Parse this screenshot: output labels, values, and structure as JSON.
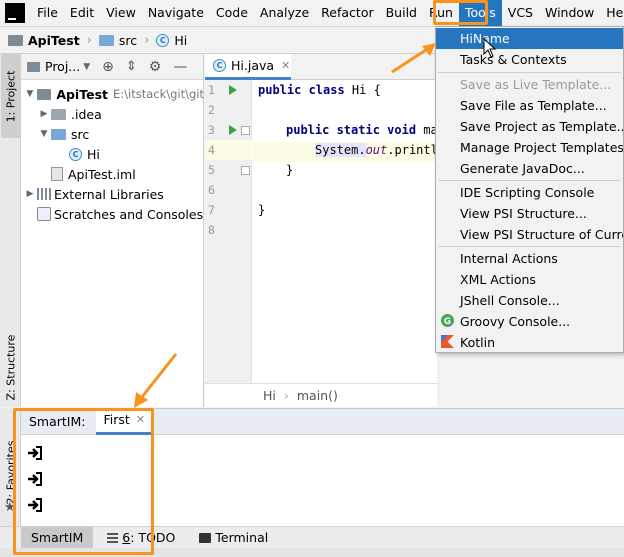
{
  "menubar": {
    "items": [
      "File",
      "Edit",
      "View",
      "Navigate",
      "Code",
      "Analyze",
      "Refactor",
      "Build",
      "Run",
      "Tools",
      "VCS",
      "Window",
      "Help"
    ],
    "active_index": 9
  },
  "navbar": {
    "project": "ApiTest",
    "folder": "src",
    "file": "Hi"
  },
  "left_strip": {
    "project_tab": "1: Project",
    "structure_tab": "Z: Structure",
    "favorites_tab": "2: Favorites"
  },
  "project_panel": {
    "title": "Proj...",
    "tree": [
      {
        "label": "ApiTest",
        "path": "E:\\itstack\\git\\git"
      },
      {
        "label": ".idea"
      },
      {
        "label": "src"
      },
      {
        "label": "Hi"
      },
      {
        "label": "ApiTest.iml"
      },
      {
        "label": "External Libraries"
      },
      {
        "label": "Scratches and Consoles"
      }
    ]
  },
  "editor": {
    "tab_label": "Hi.java",
    "line_numbers": [
      "1",
      "2",
      "3",
      "4",
      "5",
      "6",
      "7",
      "8"
    ],
    "lines": {
      "l1_kw": "public class",
      "l1_rest": " Hi {",
      "l3_kw": "public static void",
      "l3_rest": " ma",
      "l4_a": "System.",
      "l4_b": "out",
      "l4_c": ".printl",
      "l5": "}",
      "l7": "}"
    },
    "breadcrumb": {
      "class": "Hi",
      "method": "main()"
    }
  },
  "tools_menu": {
    "items": [
      {
        "label": "HiName",
        "selected": true
      },
      {
        "label": "Tasks & Contexts"
      },
      {
        "label": "Save as Live Template...",
        "disabled": true
      },
      {
        "label": "Save File as Template..."
      },
      {
        "label": "Save Project as Template..."
      },
      {
        "label": "Manage Project Templates..."
      },
      {
        "label": "Generate JavaDoc..."
      },
      {
        "label": "IDE Scripting Console"
      },
      {
        "label": "View PSI Structure..."
      },
      {
        "label": "View PSI Structure of Current File"
      },
      {
        "label": "Internal Actions"
      },
      {
        "label": "XML Actions"
      },
      {
        "label": "JShell Console..."
      },
      {
        "label": "Groovy Console..."
      },
      {
        "label": "Kotlin"
      }
    ]
  },
  "smartim": {
    "label": "SmartIM:",
    "tab": "First"
  },
  "bottom_tabs": {
    "smartim": "SmartIM",
    "todo_num": "6",
    "todo_rest": ": TODO",
    "terminal": "Terminal"
  },
  "colors": {
    "accent": "#2675bf",
    "highlight_box": "#f7941d",
    "run_green": "#3aa540"
  }
}
